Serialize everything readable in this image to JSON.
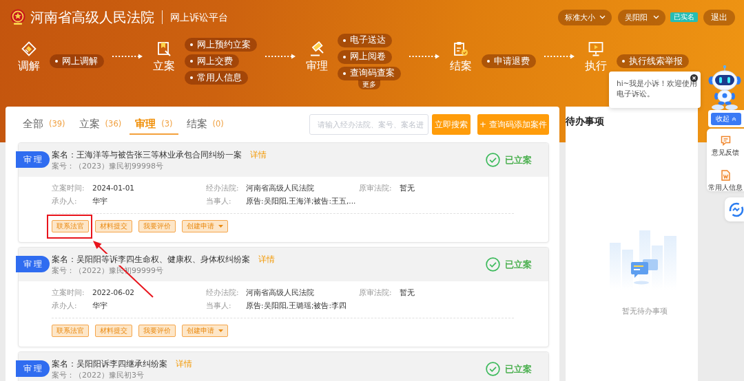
{
  "header": {
    "court_name": "河南省高级人民法院",
    "platform_name": "网上诉讼平台",
    "text_size_menu": "标准大小",
    "user_menu": "吴阳阳",
    "verified_badge": "已实名",
    "logout_button": "退出"
  },
  "process_nav": [
    {
      "label": "调解",
      "links": [
        "网上调解"
      ]
    },
    {
      "label": "立案",
      "links": [
        "网上预约立案",
        "网上交费",
        "常用人信息"
      ]
    },
    {
      "label": "审理",
      "links": [
        "电子送达",
        "网上阅卷",
        "查询码查案"
      ],
      "more": "更多"
    },
    {
      "label": "结案",
      "links": [
        "申请退费"
      ]
    },
    {
      "label": "执行",
      "links": [
        "执行线索举报"
      ]
    }
  ],
  "tabs": [
    {
      "label": "全部",
      "count": "(39)",
      "selected": false
    },
    {
      "label": "立案",
      "count": "(36)",
      "selected": false
    },
    {
      "label": "审理",
      "count": "(3)",
      "selected": true
    },
    {
      "label": "结案",
      "count": "(0)",
      "selected": false
    }
  ],
  "search": {
    "placeholder": "请输入经办法院、案号、案名进",
    "button": "立即搜索"
  },
  "add_case_button": "+ 查询码添加案件",
  "cases": [
    {
      "stage_badge": "审 理",
      "name": "案名：王海洋等与被告张三等林业承包合同纠纷一案",
      "detail_link": "详情",
      "number": "案号：（2023）豫民初99998号",
      "status": "已立案",
      "fields": [
        {
          "label": "立案时间:",
          "value": "2024-01-01"
        },
        {
          "label": "经办法院:",
          "value": "河南省高级人民法院"
        },
        {
          "label": "原审法院:",
          "value": "暂无"
        },
        {
          "label": "承办人:",
          "value": "华宇"
        },
        {
          "label": "当事人:",
          "value": "原告:吴阳阳,王海洋;被告:王五,..."
        }
      ],
      "actions": [
        {
          "label": "联系法官",
          "dropdown": false
        },
        {
          "label": "材料提交",
          "dropdown": false
        },
        {
          "label": "我要评价",
          "dropdown": false
        },
        {
          "label": "创建申请",
          "dropdown": true
        }
      ]
    },
    {
      "stage_badge": "审 理",
      "name": "案名：吴阳阳等诉李四生命权、健康权、身体权纠纷案",
      "detail_link": "详情",
      "number": "案号：（2022）豫民初99999号",
      "status": "已立案",
      "fields": [
        {
          "label": "立案时间:",
          "value": "2022-06-02"
        },
        {
          "label": "经办法院:",
          "value": "河南省高级人民法院"
        },
        {
          "label": "原审法院:",
          "value": "暂无"
        },
        {
          "label": "承办人:",
          "value": "华宇"
        },
        {
          "label": "当事人:",
          "value": "原告:吴阳阳,王璐瑶;被告:李四"
        }
      ],
      "actions": [
        {
          "label": "联系法官",
          "dropdown": false
        },
        {
          "label": "材料提交",
          "dropdown": false
        },
        {
          "label": "我要评价",
          "dropdown": false
        },
        {
          "label": "创建申请",
          "dropdown": true
        }
      ]
    },
    {
      "stage_badge": "审 理",
      "name": "案名：吴阳阳诉李四继承纠纷案",
      "detail_link": "详情",
      "number": "案号：（2022）豫民初3号",
      "status": "已立案"
    }
  ],
  "todo_panel": {
    "title": "待办事项",
    "empty_text": "暂无待办事项"
  },
  "assistant": {
    "greeting": "hi~我是小诉！欢迎使用电子诉讼。",
    "collapse_button": "收起"
  },
  "side_tools": [
    {
      "label": "意见反馈"
    },
    {
      "label": "常用人信息"
    }
  ],
  "annotation": {
    "highlight_frame": true,
    "arrow": true
  }
}
